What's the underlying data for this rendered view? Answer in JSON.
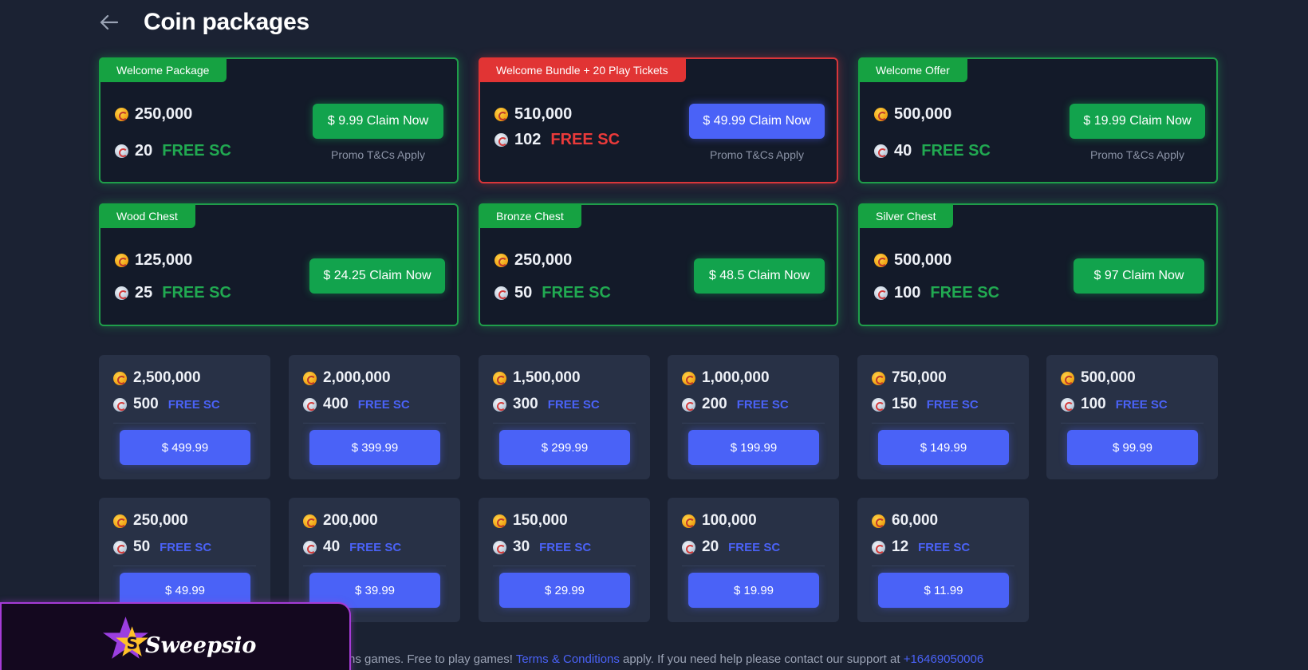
{
  "header": {
    "title": "Coin packages"
  },
  "featured": [
    {
      "tag": "Welcome Package",
      "coins": "250,000",
      "sc": "20",
      "free_label": "FREE SC",
      "button": "$ 9.99 Claim Now",
      "promo": "Promo T&Cs Apply"
    },
    {
      "tag": "Welcome Bundle + 20 Play Tickets",
      "coins": "510,000",
      "sc": "102",
      "free_label": "FREE SC",
      "button": "$ 49.99 Claim Now",
      "promo": "Promo T&Cs Apply"
    },
    {
      "tag": "Welcome Offer",
      "coins": "500,000",
      "sc": "40",
      "free_label": "FREE SC",
      "button": "$ 19.99 Claim Now",
      "promo": "Promo T&Cs Apply"
    },
    {
      "tag": "Wood Chest",
      "coins": "125,000",
      "sc": "25",
      "free_label": "FREE SC",
      "button": "$ 24.25 Claim Now"
    },
    {
      "tag": "Bronze Chest",
      "coins": "250,000",
      "sc": "50",
      "free_label": "FREE SC",
      "button": "$ 48.5 Claim Now"
    },
    {
      "tag": "Silver Chest",
      "coins": "500,000",
      "sc": "100",
      "free_label": "FREE SC",
      "button": "$ 97 Claim Now"
    }
  ],
  "packages": [
    {
      "coins": "2,500,000",
      "sc": "500",
      "free_label": "FREE SC",
      "price": "$ 499.99"
    },
    {
      "coins": "2,000,000",
      "sc": "400",
      "free_label": "FREE SC",
      "price": "$ 399.99"
    },
    {
      "coins": "1,500,000",
      "sc": "300",
      "free_label": "FREE SC",
      "price": "$ 299.99"
    },
    {
      "coins": "1,000,000",
      "sc": "200",
      "free_label": "FREE SC",
      "price": "$ 199.99"
    },
    {
      "coins": "750,000",
      "sc": "150",
      "free_label": "FREE SC",
      "price": "$ 149.99"
    },
    {
      "coins": "500,000",
      "sc": "100",
      "free_label": "FREE SC",
      "price": "$ 99.99"
    },
    {
      "coins": "250,000",
      "sc": "50",
      "free_label": "FREE SC",
      "price": "$ 49.99"
    },
    {
      "coins": "200,000",
      "sc": "40",
      "free_label": "FREE SC",
      "price": "$ 39.99"
    },
    {
      "coins": "150,000",
      "sc": "30",
      "free_label": "FREE SC",
      "price": "$ 29.99"
    },
    {
      "coins": "100,000",
      "sc": "20",
      "free_label": "FREE SC",
      "price": "$ 19.99"
    },
    {
      "coins": "60,000",
      "sc": "12",
      "free_label": "FREE SC",
      "price": "$ 11.99"
    }
  ],
  "footer": {
    "text_start": "ns games. Free to play games! ",
    "terms_link": "Terms & Conditions",
    "text_mid": " apply. If you need help please contact our support at ",
    "phone_link": "+16469050006"
  },
  "brand": {
    "name": "Sweepsio"
  },
  "colors": {
    "green": "#16a242",
    "red": "#e13434",
    "blue": "#4a62f7",
    "background": "#1b2233"
  },
  "icons": {
    "back": "arrow-left-icon",
    "coin": "gold-coin-icon",
    "sc": "silver-coin-icon",
    "logo": "star-logo-icon"
  }
}
